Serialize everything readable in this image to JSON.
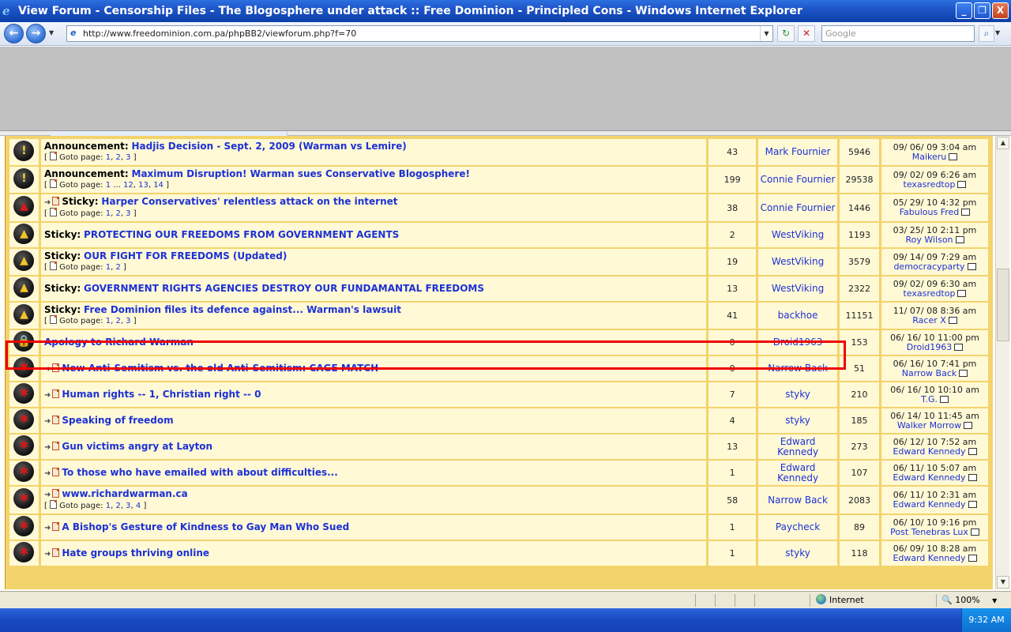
{
  "window": {
    "title": "View Forum - Censorship Files - The Blogosphere under attack :: Free Dominion - Principled Cons - Windows Internet Explorer",
    "minimize": "_",
    "maximize": "❐",
    "close": "X"
  },
  "nav": {
    "back": "←",
    "forward": "→",
    "address": "http://www.freedominion.com.pa/phpBB2/viewforum.php?f=70",
    "search_placeholder": "Google",
    "refresh": "↻",
    "stop": "✕",
    "search_go": "🔍"
  },
  "colors": {
    "highlight": "#ee0000",
    "link": "#1d31d6",
    "row_bg": "#fff9d6",
    "forum_border": "#f3d36b"
  },
  "goto_label": "Goto page:",
  "topics": [
    {
      "icon": "announcement-icon",
      "glyph": "!",
      "cls": "ann",
      "newpost": false,
      "prefix": "Announcement:",
      "title": "Hadjis Decision - Sept. 2, 2009 (Warman vs Lemire)",
      "pages": [
        "1",
        "2",
        "3"
      ],
      "replies": "43",
      "author": "Mark Fournier",
      "views": "5946",
      "last_date": "09/ 06/ 09 3:04 am",
      "last_user": "Maikeru"
    },
    {
      "icon": "announcement-icon",
      "glyph": "!",
      "cls": "ann",
      "newpost": false,
      "prefix": "Announcement:",
      "title": "Maximum Disruption! Warman sues Conservative Blogosphere!",
      "pages": [
        "1",
        "...",
        "12",
        "13",
        "14"
      ],
      "replies": "199",
      "author": "Connie Fournier",
      "views": "29538",
      "last_date": "09/ 02/ 09 6:26 am",
      "last_user": "texasredtop"
    },
    {
      "icon": "hot-sticky-icon",
      "glyph": "▲",
      "cls": "hot",
      "newpost": true,
      "prefix": "Sticky:",
      "title": "Harper Conservatives' relentless attack on the internet",
      "pages": [
        "1",
        "2",
        "3"
      ],
      "replies": "38",
      "author": "Connie Fournier",
      "views": "1446",
      "last_date": "05/ 29/ 10 4:32 pm",
      "last_user": "Fabulous Fred"
    },
    {
      "icon": "sticky-icon",
      "glyph": "▲",
      "cls": "stk",
      "newpost": false,
      "prefix": "Sticky:",
      "title": "PROTECTING OUR FREEDOMS FROM GOVERNMENT AGENTS",
      "pages": [],
      "replies": "2",
      "author": "WestViking",
      "views": "1193",
      "last_date": "03/ 25/ 10 2:11 pm",
      "last_user": "Roy Wilson"
    },
    {
      "icon": "sticky-icon",
      "glyph": "▲",
      "cls": "stk",
      "newpost": false,
      "prefix": "Sticky:",
      "title": "OUR FIGHT FOR FREEDOMS (Updated)",
      "pages": [
        "1",
        "2"
      ],
      "replies": "19",
      "author": "WestViking",
      "views": "3579",
      "last_date": "09/ 14/ 09 7:29 am",
      "last_user": "democracyparty"
    },
    {
      "icon": "sticky-icon",
      "glyph": "▲",
      "cls": "stk",
      "newpost": false,
      "prefix": "Sticky:",
      "title": "GOVERNMENT RIGHTS AGENCIES DESTROY OUR FUNDAMANTAL FREEDOMS",
      "pages": [],
      "replies": "13",
      "author": "WestViking",
      "views": "2322",
      "last_date": "09/ 02/ 09 6:30 am",
      "last_user": "texasredtop"
    },
    {
      "icon": "sticky-icon",
      "glyph": "▲",
      "cls": "stk",
      "newpost": false,
      "prefix": "Sticky:",
      "title": "Free Dominion files its defence against... Warman's lawsuit",
      "pages": [
        "1",
        "2",
        "3"
      ],
      "replies": "41",
      "author": "backhoe",
      "views": "11151",
      "last_date": "11/ 07/ 08 8:36 am",
      "last_user": "Racer X"
    },
    {
      "icon": "locked-icon",
      "glyph": "🔒",
      "cls": "lck",
      "newpost": false,
      "prefix": "",
      "title": "Apology to Richard Warman",
      "pages": [],
      "replies": "0",
      "author": "Droid1963",
      "views": "153",
      "last_date": "06/ 16/ 10 11:00 pm",
      "last_user": "Droid1963"
    },
    {
      "icon": "new-post-icon",
      "glyph": "✱",
      "cls": "nor",
      "newpost": true,
      "prefix": "",
      "title": "New Anti-Semitism vs. the old Anti-Semitism: CAGE MATCH",
      "pages": [],
      "replies": "0",
      "author": "Narrow Back",
      "views": "51",
      "last_date": "06/ 16/ 10 7:41 pm",
      "last_user": "Narrow Back"
    },
    {
      "icon": "new-post-icon",
      "glyph": "✱",
      "cls": "nor",
      "newpost": true,
      "prefix": "",
      "title": "Human rights -- 1, Christian right -- 0",
      "pages": [],
      "replies": "7",
      "author": "styky",
      "views": "210",
      "last_date": "06/ 16/ 10 10:10 am",
      "last_user": "T.G."
    },
    {
      "icon": "new-post-icon",
      "glyph": "✱",
      "cls": "nor",
      "newpost": true,
      "prefix": "",
      "title": "Speaking of freedom",
      "pages": [],
      "replies": "4",
      "author": "styky",
      "views": "185",
      "last_date": "06/ 14/ 10 11:45 am",
      "last_user": "Walker Morrow"
    },
    {
      "icon": "new-post-icon",
      "glyph": "✱",
      "cls": "nor",
      "newpost": true,
      "prefix": "",
      "title": "Gun victims angry at Layton",
      "pages": [],
      "replies": "13",
      "author": "Edward Kennedy",
      "views": "273",
      "last_date": "06/ 12/ 10 7:52 am",
      "last_user": "Edward Kennedy"
    },
    {
      "icon": "new-post-icon",
      "glyph": "✱",
      "cls": "nor",
      "newpost": true,
      "prefix": "",
      "title": "To those who have emailed with about difficulties...",
      "pages": [],
      "replies": "1",
      "author": "Edward Kennedy",
      "views": "107",
      "last_date": "06/ 11/ 10 5:07 am",
      "last_user": "Edward Kennedy"
    },
    {
      "icon": "new-post-icon",
      "glyph": "✱",
      "cls": "nor",
      "newpost": true,
      "prefix": "",
      "title": "www.richardwarman.ca",
      "pages": [
        "1",
        "2",
        "3",
        "4"
      ],
      "replies": "58",
      "author": "Narrow Back",
      "views": "2083",
      "last_date": "06/ 11/ 10 2:31 am",
      "last_user": "Edward Kennedy"
    },
    {
      "icon": "new-post-icon",
      "glyph": "✱",
      "cls": "nor",
      "newpost": true,
      "prefix": "",
      "title": "A Bishop's Gesture of Kindness to Gay Man Who Sued",
      "pages": [],
      "replies": "1",
      "author": "Paycheck",
      "views": "89",
      "last_date": "06/ 10/ 10 9:16 pm",
      "last_user": "Post Tenebras Lux"
    },
    {
      "icon": "new-post-icon",
      "glyph": "✱",
      "cls": "nor",
      "newpost": true,
      "prefix": "",
      "title": "Hate groups thriving online",
      "pages": [],
      "replies": "1",
      "author": "styky",
      "views": "118",
      "last_date": "06/ 09/ 10 8:28 am",
      "last_user": "Edward Kennedy"
    }
  ],
  "status": {
    "zone": "Internet",
    "zoom": "100%",
    "zoom_arrow": "▼"
  },
  "taskbar": {
    "clock": "9:32 AM"
  }
}
